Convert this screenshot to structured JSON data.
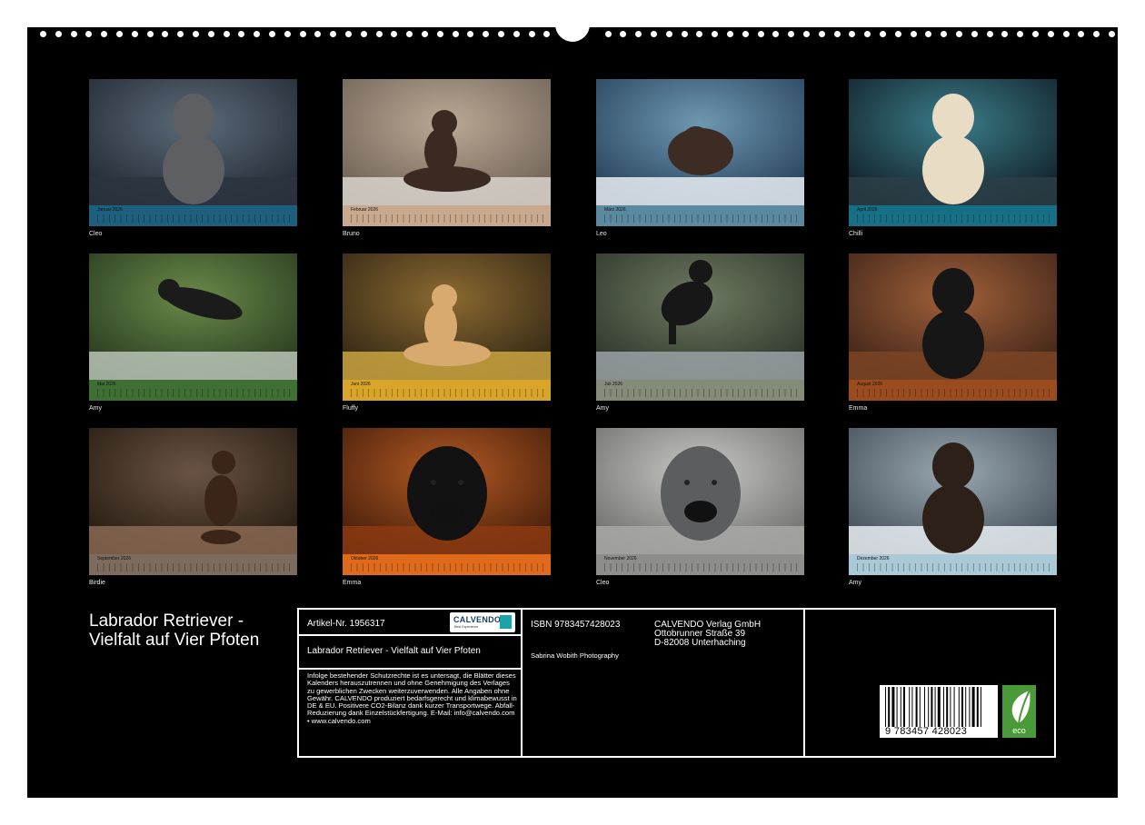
{
  "months": [
    {
      "name": "Januar 2026",
      "dog": "Cleo",
      "bar_color": "#1f5f7e",
      "scene": {
        "bg1": "#5c6a78",
        "bg2": "#1e2630",
        "ground": "#2b3440",
        "dog": "#5d5f63",
        "pose": "sit"
      }
    },
    {
      "name": "Februar 2026",
      "dog": "Bruno",
      "bar_color": "#c8a98e",
      "scene": {
        "bg1": "#bba995",
        "bg2": "#6a5e52",
        "ground": "#d9d3cc",
        "dog": "#3b2a22",
        "pose": "lie"
      }
    },
    {
      "name": "März 2026",
      "dog": "Leo",
      "bar_color": "#5a89a0",
      "scene": {
        "bg1": "#6f97b2",
        "bg2": "#223d55",
        "ground": "#e8eef2",
        "dog": "#3d2c24",
        "pose": "peek"
      }
    },
    {
      "name": "April 2026",
      "dog": "Chilli",
      "bar_color": "#176f86",
      "scene": {
        "bg1": "#3a7d8a",
        "bg2": "#0f1a22",
        "ground": "#2a3e46",
        "dog": "#e8dcc4",
        "pose": "sit"
      }
    },
    {
      "name": "Mai 2026",
      "dog": "Amy",
      "bar_color": "#3f6f32",
      "scene": {
        "bg1": "#6a8a4a",
        "bg2": "#25361c",
        "ground": "#b9c4b6",
        "dog": "#1b1b1b",
        "pose": "jump"
      }
    },
    {
      "name": "Juni 2026",
      "dog": "Fluffy",
      "bar_color": "#d8a52a",
      "scene": {
        "bg1": "#8a6a30",
        "bg2": "#2e2214",
        "ground": "#caa440",
        "dog": "#d9aa70",
        "pose": "lie"
      }
    },
    {
      "name": "Juli 2026",
      "dog": "Amy",
      "bar_color": "#858b79",
      "scene": {
        "bg1": "#6d7a62",
        "bg2": "#2b3226",
        "ground": "#9aa2a6",
        "dog": "#171717",
        "pose": "run"
      }
    },
    {
      "name": "August 2026",
      "dog": "Emma",
      "bar_color": "#9a4c1e",
      "scene": {
        "bg1": "#a0603a",
        "bg2": "#3a2116",
        "ground": "#7b4424",
        "dog": "#161616",
        "pose": "sit"
      }
    },
    {
      "name": "September 2026",
      "dog": "Birdie",
      "bar_color": "#7d6b5e",
      "scene": {
        "bg1": "#6a5444",
        "bg2": "#22180f",
        "ground": "#8a6a52",
        "dog": "#3a2518",
        "pose": "beg"
      }
    },
    {
      "name": "Oktober 2026",
      "dog": "Emma",
      "bar_color": "#df6a1c",
      "scene": {
        "bg1": "#b45a22",
        "bg2": "#3e1a0a",
        "ground": "#8b3a12",
        "dog": "#121212",
        "pose": "face"
      }
    },
    {
      "name": "November 2026",
      "dog": "Cleo",
      "bar_color": "#8d8e8c",
      "scene": {
        "bg1": "#c8c8c6",
        "bg2": "#6a6a68",
        "ground": "#a8a8a6",
        "dog": "#5c5d5f",
        "pose": "face"
      }
    },
    {
      "name": "Dezember 2026",
      "dog": "Amy",
      "bar_color": "#a9c9d6",
      "scene": {
        "bg1": "#9aa8b2",
        "bg2": "#3e4a54",
        "ground": "#e9eef2",
        "dog": "#2d2019",
        "pose": "sit"
      }
    }
  ],
  "title": "Labrador Retriever - Vielfalt auf Vier Pfoten",
  "info": {
    "article": "Artikel-Nr. 1956317",
    "logo_text": "CALVENDO",
    "logo_sub": "Best Experience",
    "book_title": "Labrador Retriever - Vielfalt auf Vier Pfoten",
    "legal": "Infolge bestehender Schutzrechte ist es untersagt, die Blätter dieses Kalenders herauszutrennen und ohne Genehmigung des Verlages zu gewerblichen Zwecken weiterzuverwenden. Alle Angaben ohne Gewähr. CALVENDO produziert bedarfsgerecht und klimabewusst in DE & EU. Positivere CO2-Bilanz dank kurzer Transportwege. Abfall-Reduzierung dank Einzelstückfertigung. E-Mail: info@calvendo.com • www.calvendo.com",
    "isbn": "ISBN 9783457428023",
    "photographer": "Sabrina Wobith Photography",
    "publisher_lines": [
      "CALVENDO Verlag GmbH",
      "Ottobrunner Straße 39",
      "D-82008 Unterhaching"
    ],
    "barcode_digits": "9 783457 428023",
    "eco_label": "eco"
  }
}
